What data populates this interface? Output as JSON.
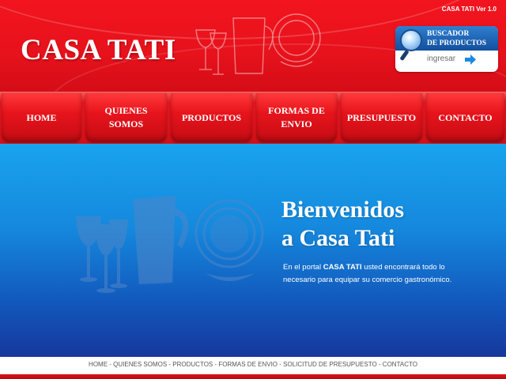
{
  "header": {
    "version": "CASA TATI Ver 1.0",
    "logo": "CASA TATI"
  },
  "buscador": {
    "title_line1": "BUSCADOR",
    "title_line2": "DE PRODUCTOS",
    "ingresar": "ingresar"
  },
  "nav": {
    "items": [
      {
        "label": "HOME"
      },
      {
        "label": "QUIENES SOMOS"
      },
      {
        "label": "PRODUCTOS"
      },
      {
        "label": "FORMAS DE ENVIO"
      },
      {
        "label": "PRESUPUESTO"
      },
      {
        "label": "CONTACTO"
      }
    ]
  },
  "main": {
    "welcome_line1": "Bienvenidos",
    "welcome_line2": "a Casa Tati",
    "intro_pre": "En  el portal ",
    "intro_brand": "CASA TATI",
    "intro_post": " usted encontrará todo lo necesario para equipar su comercio gastronómico."
  },
  "footer": {
    "links": "HOME - QUIENES SOMOS - PRODUCTOS - FORMAS DE ENVIO - SOLICITUD DE PRESUPUESTO - CONTACTO"
  },
  "colors": {
    "header_red": "#e7121c",
    "main_blue": "#1588dd",
    "buscador_blue": "#124f9d"
  }
}
